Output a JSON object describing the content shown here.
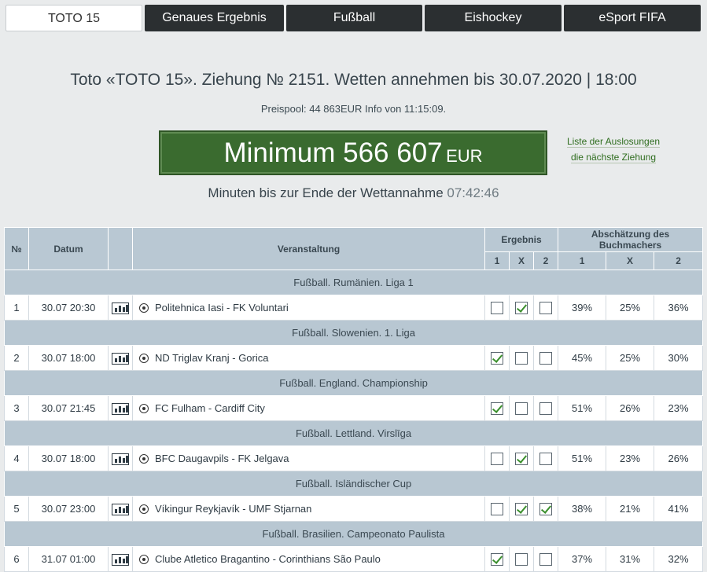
{
  "tabs": [
    "TOTO 15",
    "Genaues Ergebnis",
    "Fußball",
    "Eishockey",
    "eSport FIFA"
  ],
  "header": {
    "title": "Toto «TOTO 15». Ziehung № 2151. Wetten annehmen bis 30.07.2020 | 18:00",
    "pool": "Preispool: 44 863EUR Info von 11:15:09.",
    "jackpot_label": "Minimum 566 607",
    "jackpot_currency": "EUR",
    "link1": "Liste der Auslosungen",
    "link2": "die nächste Ziehung",
    "countdown_label": "Minuten bis zur Ende der Wettannahme",
    "countdown_time": "07:42:46"
  },
  "table": {
    "headers": {
      "no": "№",
      "date": "Datum",
      "event": "Veranstaltung",
      "result": "Ergebnis",
      "estimate": "Abschätzung des Buchmachers",
      "r1": "1",
      "rx": "X",
      "r2": "2",
      "e1": "1",
      "ex": "X",
      "e2": "2"
    },
    "rows": [
      {
        "group": "Fußball. Rumänien. Liga 1",
        "no": "1",
        "date": "30.07 20:30",
        "event": "Politehnica Iasi - FK Voluntari",
        "checks": [
          false,
          true,
          false
        ],
        "p1": "39%",
        "px": "25%",
        "p2": "36%"
      },
      {
        "group": "Fußball. Slowenien. 1. Liga",
        "no": "2",
        "date": "30.07 18:00",
        "event": "ND Triglav Kranj - Gorica",
        "checks": [
          true,
          false,
          false
        ],
        "p1": "45%",
        "px": "25%",
        "p2": "30%"
      },
      {
        "group": "Fußball. England. Championship",
        "no": "3",
        "date": "30.07 21:45",
        "event": "FC Fulham - Cardiff City",
        "checks": [
          true,
          false,
          false
        ],
        "p1": "51%",
        "px": "26%",
        "p2": "23%"
      },
      {
        "group": "Fußball. Lettland. Virslīga",
        "no": "4",
        "date": "30.07 18:00",
        "event": "BFC Daugavpils - FK Jelgava",
        "checks": [
          false,
          true,
          false
        ],
        "p1": "51%",
        "px": "23%",
        "p2": "26%"
      },
      {
        "group": "Fußball. Isländischer Cup",
        "no": "5",
        "date": "30.07 23:00",
        "event": "Víkingur Reykjavík - UMF Stjarnan",
        "checks": [
          false,
          true,
          true
        ],
        "p1": "38%",
        "px": "21%",
        "p2": "41%"
      },
      {
        "group": "Fußball. Brasilien. Campeonato Paulista",
        "no": "6",
        "date": "31.07 01:00",
        "event": "Clube Atletico Bragantino - Corinthians São Paulo",
        "checks": [
          true,
          false,
          false
        ],
        "p1": "37%",
        "px": "31%",
        "p2": "32%"
      }
    ]
  }
}
